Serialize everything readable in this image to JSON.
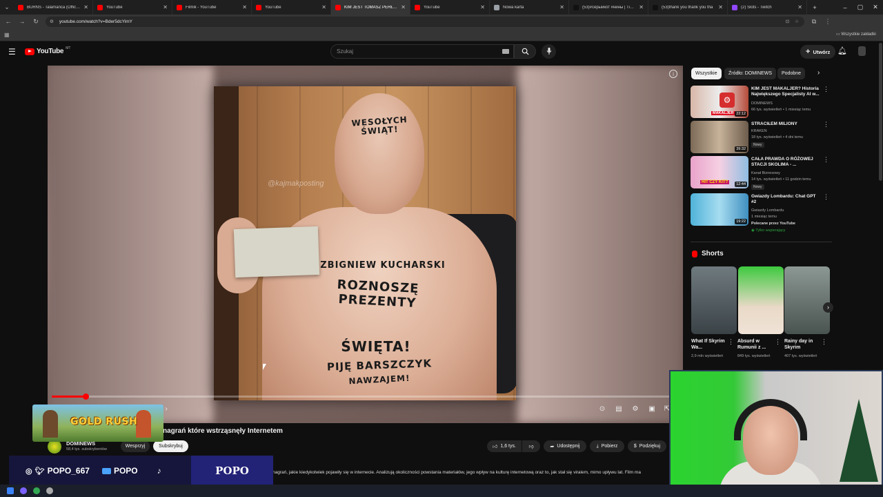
{
  "browser": {
    "tabs": [
      {
        "label": "BURNS - Talamanca (Official V",
        "color": "#ff0000",
        "active": false
      },
      {
        "label": "YouTube",
        "color": "#ff0000",
        "active": false
      },
      {
        "label": "Filmik - YouTube",
        "color": "#ff0000",
        "active": false
      },
      {
        "label": "YouTube",
        "color": "#ff0000",
        "active": false
      },
      {
        "label": "KIM JEST TOMASZ PERŁA? He",
        "color": "#ff0000",
        "active": true
      },
      {
        "label": "YouTube",
        "color": "#ff0000",
        "active": false
      },
      {
        "label": "Nowa karta",
        "color": "#9aa0a6",
        "active": false
      },
      {
        "label": "(53)#серыйкот #нины | TikTok",
        "color": "#111111",
        "active": false
      },
      {
        "label": "(53)thank you thank you tha",
        "color": "#111111",
        "active": false
      },
      {
        "label": "(2) Slots - Twitch",
        "color": "#9146ff",
        "active": false
      }
    ],
    "url": "youtube.com/watch?v=Bder5dcYimY",
    "bookmarks_label": "Wszystkie zakładki"
  },
  "yt": {
    "logo": "YouTube",
    "logo_suffix": "MT",
    "search_placeholder": "Szukaj",
    "create_label": "Utwórz"
  },
  "video": {
    "watermark": "@kajmakposting",
    "forehead_text": "WESOŁYCH ŚWIĄT!",
    "chest_line1": "ZBIGNIEW KUCHARSKI",
    "chest_line2": "ROZNOSZĘ PREZENTY",
    "belly_line1": "ŚWIĘTA!",
    "belly_line2": "PIJĘ BARSZCZYK",
    "belly_line3": "NAWZAJEM!",
    "progress": 0.055,
    "title": "nagrań które wstrząsnęły Internetem"
  },
  "channel": {
    "name": "DOMINEWS",
    "subs": "58,4 tys. subskrybentów",
    "support_label": "Wesprzyj",
    "subscribe_label": "Subskrybuj"
  },
  "actions": {
    "likes": "1,6 tys.",
    "share": "Udostępnij",
    "download": "Pobierz",
    "thanks": "Podziękuj"
  },
  "description": "nagrań, jakie kiedykolwiek pojawiły się w internecie. Analizują okoliczności powstania materiałów, jego wpływ na kulturę internetową oraz to, jak stał się viralem, mimo upływu lat. Film ma",
  "chips": [
    "Wszystkie",
    "Źródło: DOMINEWS",
    "Podobne"
  ],
  "recs": [
    {
      "title": "KIM JEST MAKALJER? Historia Największego Specjalisty AI w...",
      "channel": "DOMINEWS",
      "meta": "66 tys. wyświetleń • 1 miesiąc temu",
      "duration": "22:12",
      "badge": "",
      "thumb_label": "MAKALJER"
    },
    {
      "title": "STRACIŁEM MILIONY",
      "channel": "KRAKEN",
      "meta": "18 tys. wyświetleń • 4 dni temu",
      "duration": "39:32",
      "badge": "Nowy",
      "thumb_label": ""
    },
    {
      "title": "CAŁA PRAWDA O RÓŻOWEJ STACJI SKOLIMA - ...",
      "channel": "Kanał Biznesowy",
      "meta": "14 tys. wyświetleń • 11 godzin temu",
      "duration": "12:44",
      "badge": "Nowy",
      "thumb_label": "HIT CZY KIT?"
    },
    {
      "title": "Gwiazdy Lombardu: Chat GPT #2",
      "channel": "Gwiazdy Lombardu",
      "meta": "1 miesiąc temu",
      "duration": "19:22",
      "badge": "Polecane przez YouTube",
      "members": "Tylko wspierający",
      "thumb_label": ""
    }
  ],
  "shorts": {
    "heading": "Shorts",
    "items": [
      {
        "title": "What If Skyrim Wa...",
        "views": "2,9 mln wyświetleń"
      },
      {
        "title": "Absurd w Rumunii z ...",
        "views": "849 tys. wyświetleń"
      },
      {
        "title": "Rainy day in Skyrim",
        "views": "407 tys. wyświetleń"
      }
    ]
  },
  "overlay": {
    "goldrush": "GOLD RUSH",
    "social_handle": "POPO_667",
    "youtube_handle": "POPO",
    "brand": "POPO"
  }
}
